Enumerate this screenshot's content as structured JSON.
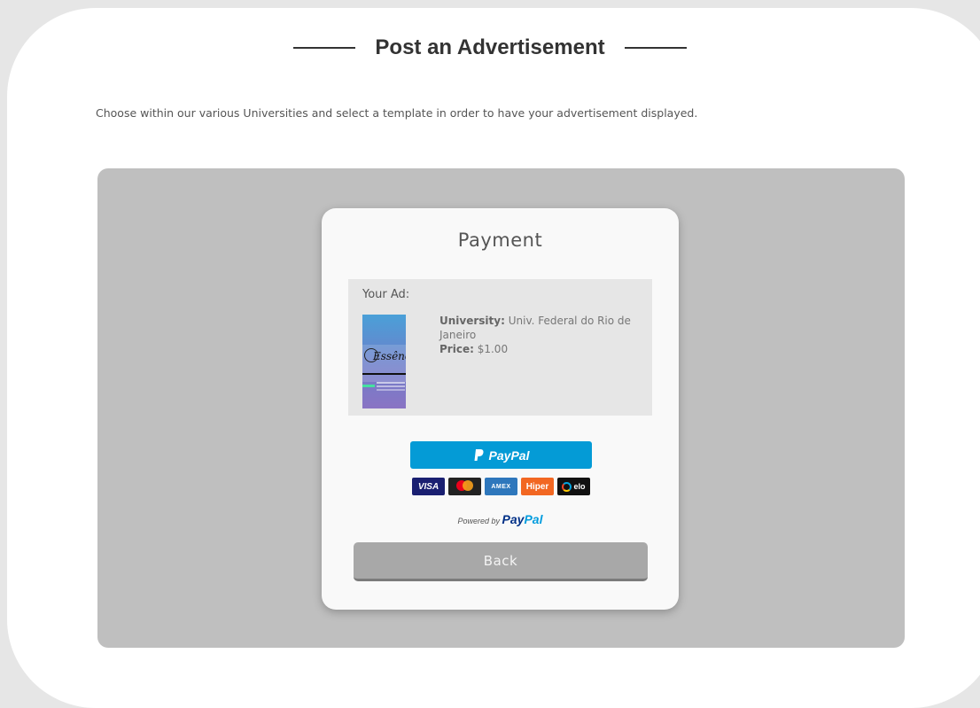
{
  "page": {
    "title": "Post an Advertisement",
    "subtitle": "Choose within our various Universities and select a template in order to have your advertisement displayed."
  },
  "payment": {
    "title": "Payment",
    "ad_label": "Your Ad:",
    "university_label": "University:",
    "university_value": "Univ. Federal do Rio de Janeiro",
    "price_label": "Price:",
    "price_value": "$1.00",
    "ad_thumbnail_text": "Essênci"
  },
  "paypal": {
    "button_label": "PayPal",
    "powered_by": "Powered by",
    "brand_pay": "Pay",
    "brand_pal": "Pal",
    "cards": [
      "VISA",
      "mastercard",
      "AMEX",
      "Hiper",
      "elo"
    ]
  },
  "actions": {
    "back_label": "Back"
  },
  "colors": {
    "paypal_blue": "#049bd6",
    "panel_gray": "#bfbfbf",
    "back_button": "#a8a8a8"
  }
}
